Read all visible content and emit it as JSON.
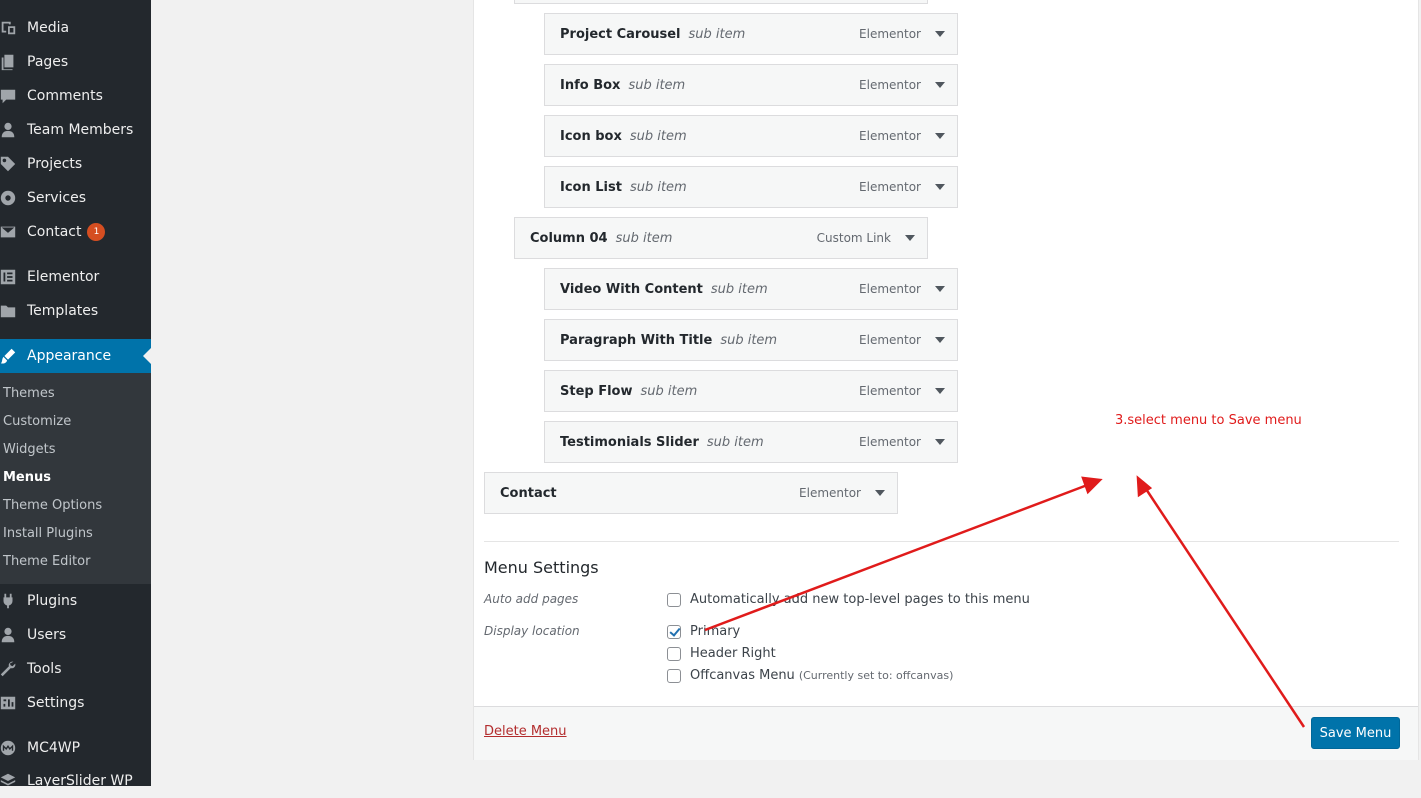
{
  "sidebar": {
    "items": [
      {
        "label": "Media",
        "icon": "media-icon"
      },
      {
        "label": "Pages",
        "icon": "pages-icon"
      },
      {
        "label": "Comments",
        "icon": "comments-icon"
      },
      {
        "label": "Team Members",
        "icon": "user-icon"
      },
      {
        "label": "Projects",
        "icon": "tag-icon"
      },
      {
        "label": "Services",
        "icon": "cog-icon"
      },
      {
        "label": "Contact",
        "icon": "mail-icon",
        "badge": "1"
      },
      {
        "label": "Elementor",
        "icon": "elementor-icon"
      },
      {
        "label": "Templates",
        "icon": "folder-icon"
      },
      {
        "label": "Appearance",
        "icon": "brush-icon",
        "active": true
      },
      {
        "label": "Plugins",
        "icon": "plug-icon"
      },
      {
        "label": "Users",
        "icon": "users-icon"
      },
      {
        "label": "Tools",
        "icon": "wrench-icon"
      },
      {
        "label": "Settings",
        "icon": "settings-icon"
      },
      {
        "label": "MC4WP",
        "icon": "mc4wp-icon"
      },
      {
        "label": "LayerSlider WP",
        "icon": "layers-icon"
      }
    ],
    "submenu": [
      {
        "label": "Themes"
      },
      {
        "label": "Customize"
      },
      {
        "label": "Widgets"
      },
      {
        "label": "Menus",
        "current": true
      },
      {
        "label": "Theme Options"
      },
      {
        "label": "Install Plugins"
      },
      {
        "label": "Theme Editor"
      }
    ]
  },
  "menu_items": [
    {
      "title": "Project Carousel",
      "sub_label": "sub item",
      "type": "Elementor",
      "depth": 2
    },
    {
      "title": "Info Box",
      "sub_label": "sub item",
      "type": "Elementor",
      "depth": 2
    },
    {
      "title": "Icon box",
      "sub_label": "sub item",
      "type": "Elementor",
      "depth": 2
    },
    {
      "title": "Icon List",
      "sub_label": "sub item",
      "type": "Elementor",
      "depth": 2
    },
    {
      "title": "Column 04",
      "sub_label": "sub item",
      "type": "Custom Link",
      "depth": 1
    },
    {
      "title": "Video With Content",
      "sub_label": "sub item",
      "type": "Elementor",
      "depth": 2
    },
    {
      "title": "Paragraph With Title",
      "sub_label": "sub item",
      "type": "Elementor",
      "depth": 2
    },
    {
      "title": "Step Flow",
      "sub_label": "sub item",
      "type": "Elementor",
      "depth": 2
    },
    {
      "title": "Testimonials Slider",
      "sub_label": "sub item",
      "type": "Elementor",
      "depth": 2
    },
    {
      "title": "Contact",
      "sub_label": "",
      "type": "Elementor",
      "depth": 0
    }
  ],
  "menu_settings": {
    "title": "Menu Settings",
    "auto_add_label": "Auto add pages",
    "auto_add_option": "Automatically add new top-level pages to this menu",
    "display_location_label": "Display location",
    "locations": [
      {
        "label": "Primary",
        "checked": true,
        "note": ""
      },
      {
        "label": "Header Right",
        "checked": false,
        "note": ""
      },
      {
        "label": "Offcanvas Menu",
        "checked": false,
        "note": "(Currently set to: offcanvas)"
      }
    ]
  },
  "footer": {
    "delete_label": "Delete Menu",
    "save_label": "Save Menu"
  },
  "annotation": {
    "text": "3.select menu to Save menu",
    "color": "#e01b1b"
  },
  "colors": {
    "sidebar_bg": "#23282d",
    "active": "#0073aa",
    "badge": "#d54e21"
  }
}
